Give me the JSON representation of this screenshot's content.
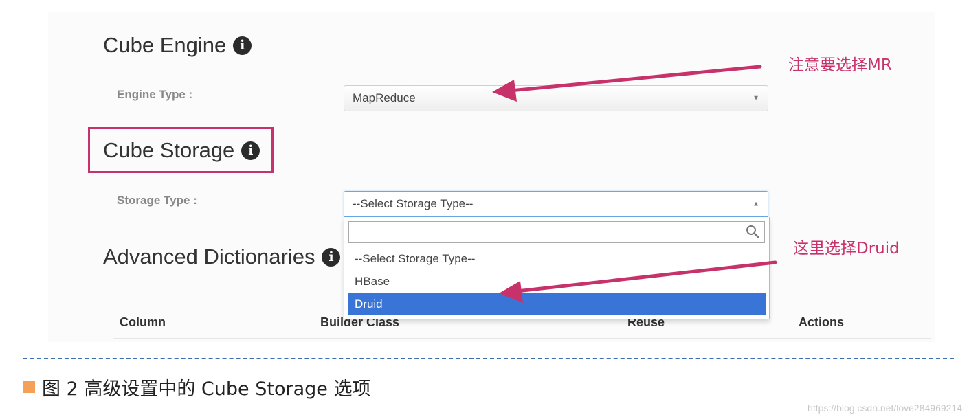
{
  "cube_engine": {
    "title": "Cube Engine",
    "info_icon": "info-icon"
  },
  "engine_type": {
    "label": "Engine Type :",
    "value": "MapReduce",
    "caret_icon": "caret-down-icon"
  },
  "cube_storage": {
    "title": "Cube Storage",
    "info_icon": "info-icon"
  },
  "storage_type": {
    "label": "Storage Type :",
    "value": "--Select Storage Type--",
    "caret_icon": "caret-up-icon",
    "search_icon": "search-icon",
    "options": [
      "--Select Storage Type--",
      "HBase",
      "Druid"
    ],
    "highlighted_option": "Druid"
  },
  "advanced_dictionaries": {
    "title": "Advanced Dictionaries",
    "info_icon": "info-icon",
    "columns": [
      "Column",
      "Builder Class",
      "Reuse",
      "Actions"
    ]
  },
  "annotations": {
    "engine_note": "注意要选择MR",
    "storage_note": "这里选择Druid",
    "color": "#c8326a"
  },
  "caption": {
    "text": "图 2 高级设置中的 Cube Storage 选项",
    "square_color": "#f4a058"
  },
  "watermark": "https://blog.csdn.net/love284969214",
  "colors": {
    "selected_option": "#3875d7",
    "separator": "#3b6db0"
  }
}
